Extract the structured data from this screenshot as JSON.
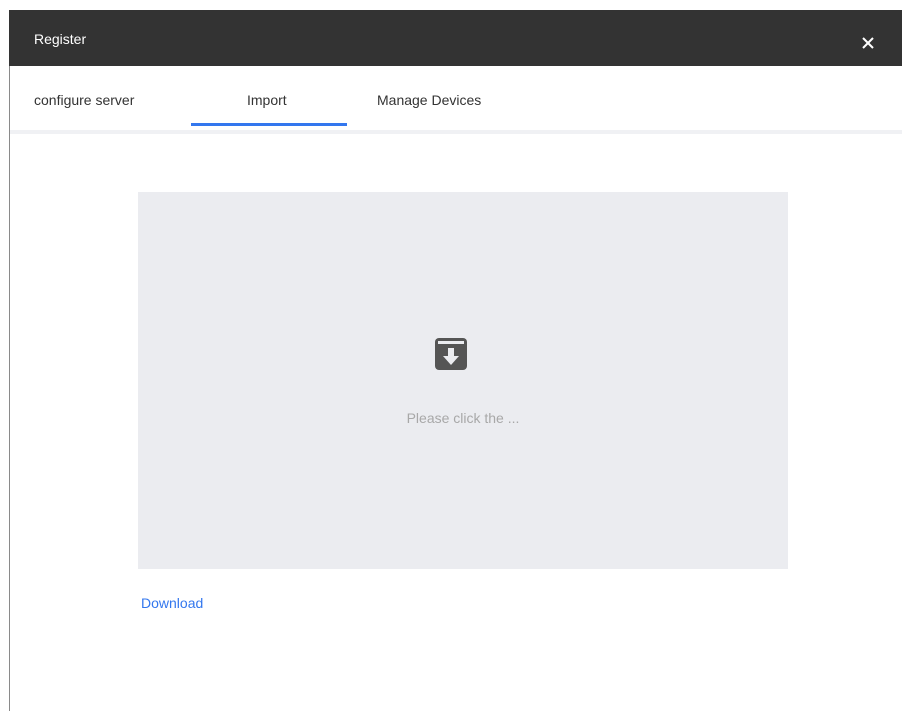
{
  "window": {
    "title": "Register",
    "close_icon": "close-icon"
  },
  "tabs": [
    {
      "label": "configure server",
      "selected": false
    },
    {
      "label": "Import",
      "selected": true
    },
    {
      "label": "Manage Devices",
      "selected": false
    }
  ],
  "import": {
    "upload_icon": "archive-download-icon",
    "hint": "Please click the ...",
    "download_link": "Download"
  },
  "colors": {
    "titlebar": "#333333",
    "accent": "#3377ee",
    "dropzone": "#ebecf0",
    "hint_text": "#a8a8a8"
  }
}
